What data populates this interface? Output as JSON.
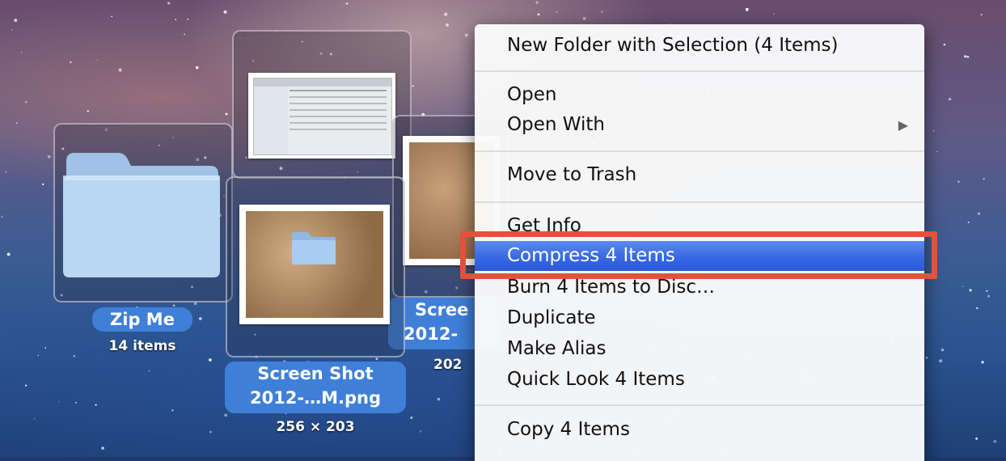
{
  "desktop_items": [
    {
      "name": "Zip Me",
      "subtitle": "14 items",
      "icon": "folder-icon"
    },
    {
      "name_line1": "Screen Shot",
      "name_line2": "2012-…M.png",
      "subtitle": "256 × 203",
      "icon": "screenshot-thumbnail"
    },
    {
      "name_line1": "Scree",
      "name_line2": "2012-",
      "subtitle": "202",
      "icon": "screenshot-thumbnail"
    },
    {
      "icon": "finder-window-thumbnail"
    }
  ],
  "context_menu": {
    "groups": [
      [
        {
          "label": "New Folder with Selection (4 Items)"
        }
      ],
      [
        {
          "label": "Open"
        },
        {
          "label": "Open With",
          "submenu_icon": "triangle-right-icon",
          "submenu_glyph": "▶"
        }
      ],
      [
        {
          "label": "Move to Trash"
        }
      ],
      [
        {
          "label": "Get Info"
        },
        {
          "label": "Compress 4 Items",
          "highlighted": true
        },
        {
          "label": "Burn 4 Items to Disc…"
        },
        {
          "label": "Duplicate"
        },
        {
          "label": "Make Alias"
        },
        {
          "label": "Quick Look 4 Items"
        }
      ],
      [
        {
          "label": "Copy 4 Items"
        }
      ]
    ]
  },
  "colors": {
    "highlight": "#3868e2",
    "annotation": "#e1523c",
    "label_pill": "#3f7fd8"
  }
}
